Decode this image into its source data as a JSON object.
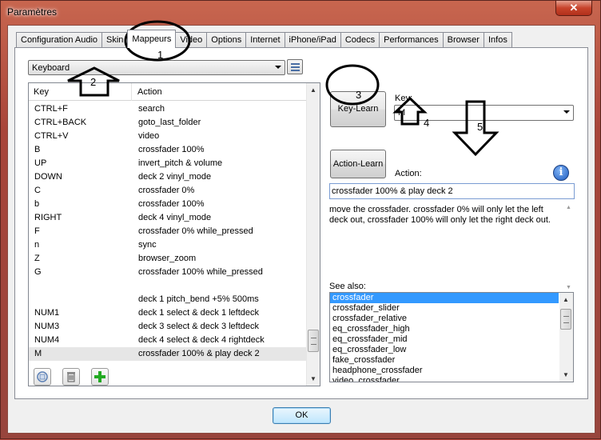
{
  "window": {
    "title": "Paramètres",
    "close_glyph": "✕"
  },
  "tabs": [
    {
      "label": "Configuration Audio"
    },
    {
      "label": "Skin"
    },
    {
      "label": "Mappeurs",
      "active": true
    },
    {
      "label": "Video"
    },
    {
      "label": "Options"
    },
    {
      "label": "Internet"
    },
    {
      "label": "iPhone/iPad"
    },
    {
      "label": "Codecs"
    },
    {
      "label": "Performances"
    },
    {
      "label": "Browser"
    },
    {
      "label": "Infos"
    }
  ],
  "mapper": {
    "device_selected": "Keyboard",
    "columns": {
      "key": "Key",
      "action": "Action"
    },
    "rows": [
      {
        "key": "CTRL+F",
        "action": "search"
      },
      {
        "key": "CTRL+BACK",
        "action": "goto_last_folder"
      },
      {
        "key": "CTRL+V",
        "action": "video"
      },
      {
        "key": "B",
        "action": "crossfader 100%"
      },
      {
        "key": "UP",
        "action": "invert_pitch & volume"
      },
      {
        "key": "DOWN",
        "action": "deck 2 vinyl_mode"
      },
      {
        "key": "C",
        "action": "crossfader 0%"
      },
      {
        "key": "b",
        "action": "crossfader 100%"
      },
      {
        "key": "RIGHT",
        "action": "deck 4 vinyl_mode"
      },
      {
        "key": "F",
        "action": "crossfader 0% while_pressed"
      },
      {
        "key": "n",
        "action": "sync"
      },
      {
        "key": "Z",
        "action": "browser_zoom"
      },
      {
        "key": "G",
        "action": "crossfader 100% while_pressed"
      },
      {
        "key": "",
        "action": ""
      },
      {
        "key": "",
        "action": "deck 1 pitch_bend +5% 500ms"
      },
      {
        "key": "NUM1",
        "action": "deck 1 select & deck 1 leftdeck"
      },
      {
        "key": "NUM3",
        "action": "deck 3 select & deck 3 leftdeck"
      },
      {
        "key": "NUM4",
        "action": "deck 4 select & deck 4 rightdeck"
      },
      {
        "key": "M",
        "action": "crossfader 100% & play deck 2",
        "selected": true
      }
    ],
    "scroll_position": 0.92
  },
  "editor": {
    "key_learn_label": "Key-Learn",
    "key_label": "Key:",
    "key_value": "M",
    "action_learn_label": "Action-Learn",
    "action_label": "Action:",
    "action_value": "crossfader 100% & play deck 2",
    "description": "move the crossfader. crossfader 0% will only let the left deck out, crossfader 100% will only let the right deck out.",
    "see_also_label": "See also:",
    "see_also": [
      "crossfader",
      "crossfader_slider",
      "crossfader_relative",
      "eq_crossfader_high",
      "eq_crossfader_mid",
      "eq_crossfader_low",
      "fake_crossfader",
      "headphone_crossfader",
      "video_crossfader"
    ],
    "info_glyph": "i"
  },
  "footer": {
    "ok_label": "OK"
  },
  "annotations": [
    "1",
    "2",
    "3",
    "4",
    "5"
  ],
  "colors": {
    "accent": "#3399ff",
    "title_bar": "#b94a3e",
    "add_icon": "#22aa22"
  }
}
